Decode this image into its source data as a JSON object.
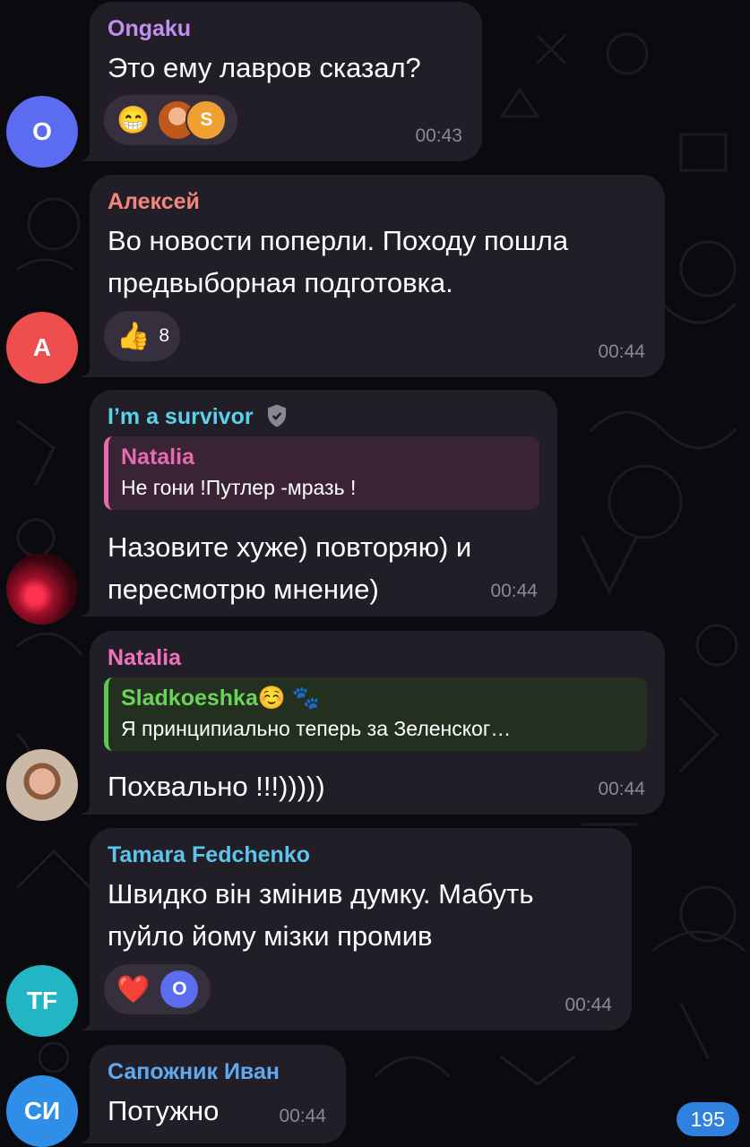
{
  "colors": {
    "background": "#0b0a0e",
    "bubble": "#221e28",
    "reaction_pill": "#36303e",
    "time": "#8c8994",
    "unread_badge": "#2f81e0"
  },
  "messages": [
    {
      "sender": "Ongaku",
      "sender_color": "#c28ff0",
      "avatar_letter": "O",
      "avatar_color": "#5b6cf0",
      "text": "Это ему лавров сказал?",
      "time": "00:43",
      "reaction": {
        "emoji": "😁",
        "reactors": [
          "photo",
          "S"
        ]
      }
    },
    {
      "sender": "Алексей",
      "sender_color": "#f3857a",
      "avatar_letter": "А",
      "avatar_color": "#ee4e4e",
      "text": "Во новости поперли. Походу пошла предвыборная подготовка.",
      "time": "00:44",
      "reaction": {
        "emoji": "👍",
        "count": "8"
      }
    },
    {
      "sender": "I’m a survivor",
      "sender_color": "#59d2ec",
      "sender_badge": "shield-icon",
      "avatar_image": "concert-photo",
      "quote": {
        "name": "Natalia",
        "name_color": "#e86bb0",
        "text": "Не гони !Путлер -мразь !"
      },
      "text": "Назовите хуже) повторяю) и пересмотрю мнение)",
      "time": "00:44"
    },
    {
      "sender": "Natalia",
      "sender_color": "#ee72bd",
      "avatar_image": "woman-photo",
      "quote": {
        "name": "Sladkoeshka☺️ 🐾",
        "name_color": "#6bd25a",
        "text": "Я принципиально теперь за Зеленског…"
      },
      "text": "Похвально !!!)))))",
      "time": "00:44"
    },
    {
      "sender": "Tamara Fedchenko",
      "sender_color": "#5fc4ec",
      "avatar_letter": "TF",
      "avatar_color": "#22b6c4",
      "text": "Швидко він змінив думку. Мабуть пуйло йому мізки промив",
      "time": "00:44",
      "reaction": {
        "emoji": "❤️",
        "reactors": [
          "O"
        ]
      }
    },
    {
      "sender": "Сапожник Иван",
      "sender_color": "#5fa9f0",
      "avatar_letter": "СИ",
      "avatar_color": "#2f8fe8",
      "text": "Потужно",
      "time": "00:44"
    }
  ],
  "unread_count": "195"
}
